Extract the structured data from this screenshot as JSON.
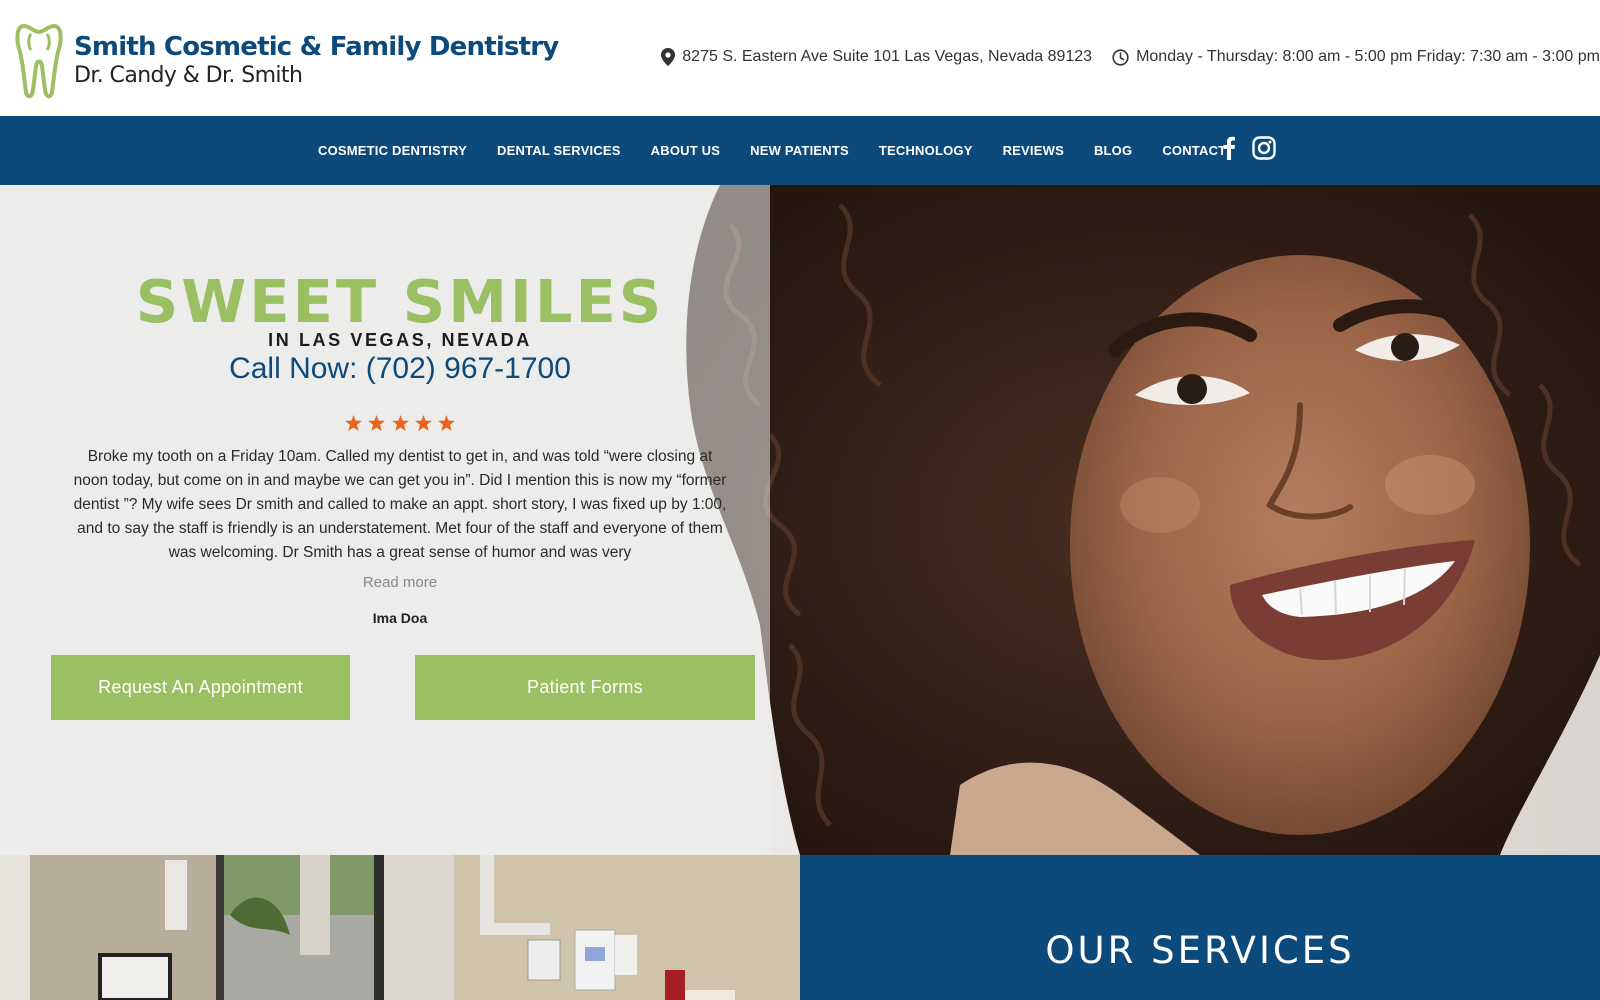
{
  "header": {
    "logo_title": "Smith Cosmetic & Family Dentistry",
    "logo_subtitle": "Dr. Candy & Dr. Smith",
    "address": "8275 S. Eastern Ave Suite 101 Las Vegas, Nevada 89123",
    "hours": "Monday - Thursday: 8:00 am - 5:00 pm Friday: 7:30 am - 3:00 pm",
    "address_icon": "map-pin-icon",
    "hours_icon": "clock-icon"
  },
  "nav": {
    "items": [
      {
        "label": "COSMETIC DENTISTRY"
      },
      {
        "label": "DENTAL SERVICES"
      },
      {
        "label": "ABOUT US"
      },
      {
        "label": "NEW PATIENTS"
      },
      {
        "label": "TECHNOLOGY"
      },
      {
        "label": "REVIEWS"
      },
      {
        "label": "BLOG"
      },
      {
        "label": "CONTACT"
      }
    ],
    "social_icons": [
      "facebook-icon",
      "instagram-icon"
    ]
  },
  "hero": {
    "title": "SWEET SMILES",
    "subtitle": "IN LAS VEGAS, NEVADA",
    "phone": "Call Now: (702) 967-1700",
    "rating": 5,
    "review_text": "Broke my tooth on a Friday 10am. Called my dentist to get in, and was told “were closing at noon today, but come on in and maybe we can get you in”. Did I mention this is now my “former dentist ”? My wife sees Dr smith and called to make an appt. short story, I was fixed up by 1:00, and to say the staff is friendly is an understatement. Met four of the staff and everyone of them was welcoming. Dr Smith has a great sense of humor and was very",
    "read_more": "Read more",
    "reviewer": "Ima Doa",
    "btn_appointment": "Request An Appointment",
    "btn_forms": "Patient Forms"
  },
  "services": {
    "title": "OUR SERVICES"
  },
  "colors": {
    "brand_blue": "#0d4a7c",
    "brand_green": "#9bc063",
    "star_orange": "#e8651e"
  }
}
